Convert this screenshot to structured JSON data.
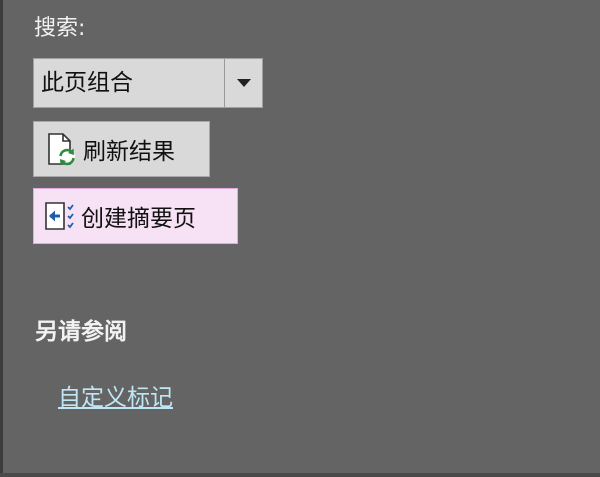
{
  "search": {
    "label": "搜索:",
    "selected": "此页组合"
  },
  "buttons": {
    "refresh_label": "刷新结果",
    "create_summary_label": "创建摘要页"
  },
  "see_also": {
    "title": "另请参阅",
    "link_label": "自定义标记"
  },
  "colors": {
    "background": "#646464",
    "summary_button_bg": "#f7e1f4",
    "link": "#bfe6f5"
  },
  "icons": {
    "dropdown": "chevron-down-icon",
    "refresh": "refresh-page-icon",
    "summary": "summary-page-icon"
  }
}
